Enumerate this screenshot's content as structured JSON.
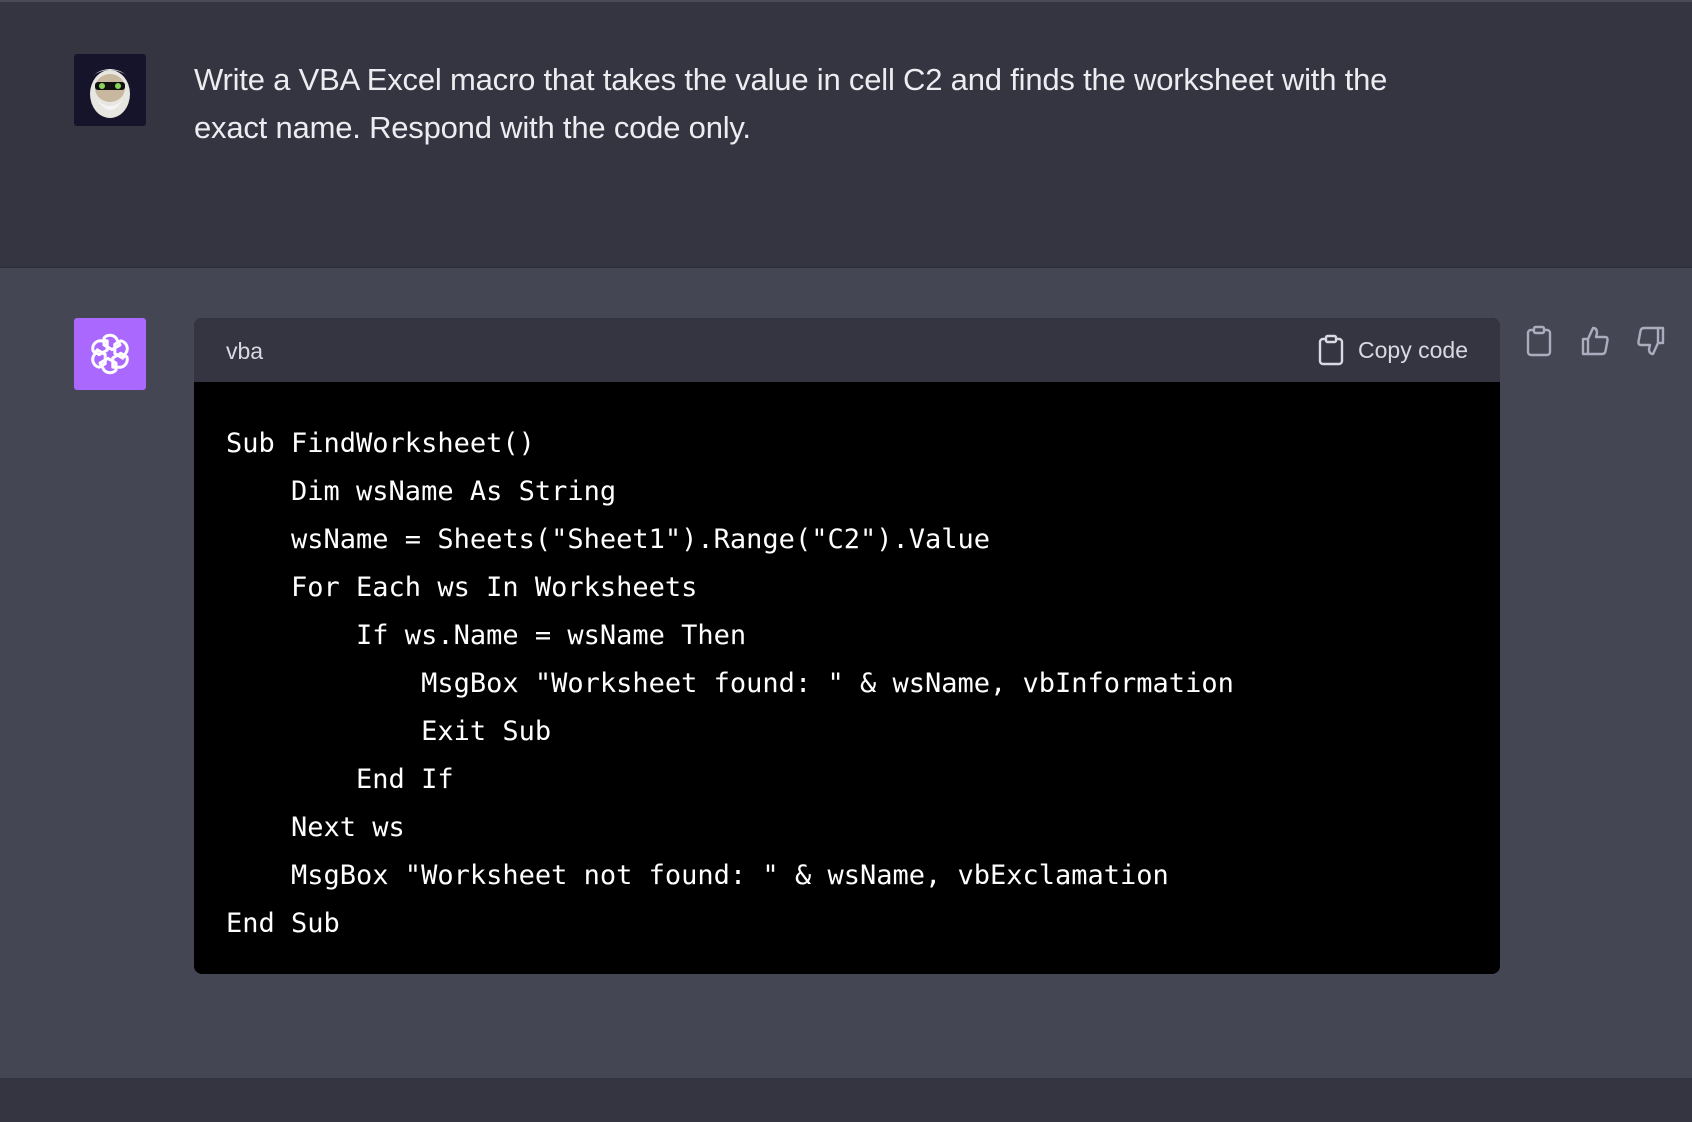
{
  "user_message": {
    "text": "Write a VBA Excel macro that takes the value in cell C2 and finds the worksheet with the exact name. Respond with the code only."
  },
  "assistant_message": {
    "code_block": {
      "language": "vba",
      "copy_label": "Copy code",
      "lines": [
        "Sub FindWorksheet()",
        "    Dim wsName As String",
        "    wsName = Sheets(\"Sheet1\").Range(\"C2\").Value",
        "    For Each ws In Worksheets",
        "        If ws.Name = wsName Then",
        "            MsgBox \"Worksheet found: \" & wsName, vbInformation",
        "            Exit Sub",
        "        End If",
        "    Next ws",
        "    MsgBox \"Worksheet not found: \" & wsName, vbExclamation",
        "End Sub"
      ]
    },
    "actions": [
      "clipboard-icon",
      "thumbs-up-icon",
      "thumbs-down-icon"
    ]
  },
  "colors": {
    "user_bg": "#343541",
    "assistant_bg": "#444654",
    "gpt_avatar": "#ab68ff",
    "code_bg": "#000000"
  }
}
